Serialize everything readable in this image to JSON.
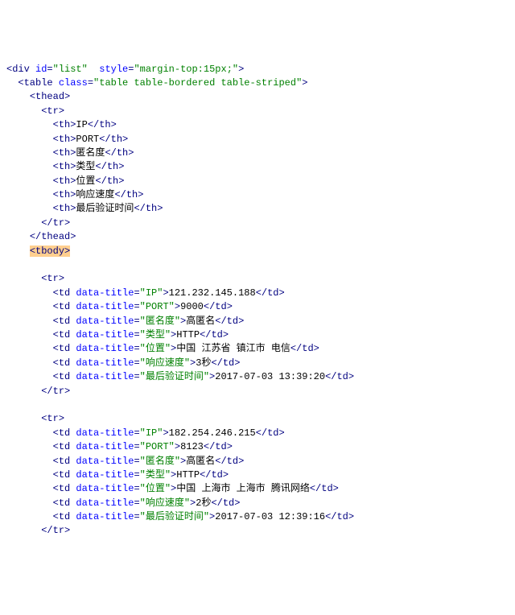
{
  "div": {
    "id": "list",
    "style": "margin-top:15px;"
  },
  "table": {
    "class": "table table-bordered table-striped"
  },
  "headers": [
    "IP",
    "PORT",
    "匿名度",
    "类型",
    "位置",
    "响应速度",
    "最后验证时间"
  ],
  "rows": [
    {
      "ip": "121.232.145.188",
      "port": "9000",
      "anon": "高匿名",
      "type": "HTTP",
      "loc": "中国 江苏省 镇江市 电信",
      "speed": "3秒",
      "time": "2017-07-03 13:39:20"
    },
    {
      "ip": "182.254.246.215",
      "port": "8123",
      "anon": "高匿名",
      "type": "HTTP",
      "loc": "中国 上海市 上海市 腾讯网络",
      "speed": "2秒",
      "time": "2017-07-03 12:39:16"
    }
  ],
  "attr_titles": {
    "ip": "IP",
    "port": "PORT",
    "anon": "匿名度",
    "type": "类型",
    "loc": "位置",
    "speed": "响应速度",
    "time": "最后验证时间"
  }
}
